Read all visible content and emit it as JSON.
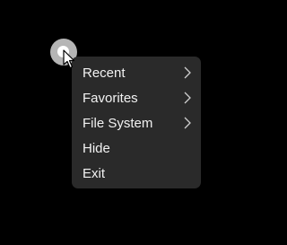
{
  "launcher": {
    "icon": "launcher-icon",
    "accent": "#b5b5b5"
  },
  "cursor": {
    "icon": "arrow-pointer-icon"
  },
  "menu": {
    "background": "#2a2a2a",
    "text_color": "#f2f2f2",
    "items": [
      {
        "label": "Recent",
        "has_submenu": true,
        "icon": "chevron-right-icon"
      },
      {
        "label": "Favorites",
        "has_submenu": true,
        "icon": "chevron-right-icon"
      },
      {
        "label": "File System",
        "has_submenu": true,
        "icon": "chevron-right-icon"
      },
      {
        "label": "Hide",
        "has_submenu": false
      },
      {
        "label": "Exit",
        "has_submenu": false
      }
    ]
  }
}
